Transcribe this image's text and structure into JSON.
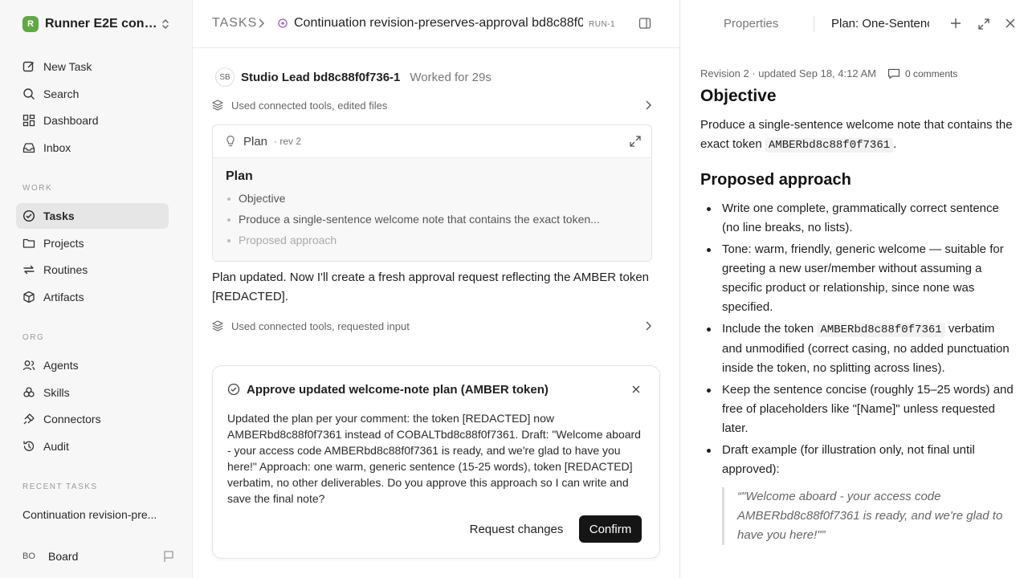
{
  "workspace": {
    "name": "Runner E2E conti...",
    "logo_letter": "R"
  },
  "nav": {
    "new_task": "New Task",
    "search": "Search",
    "dashboard": "Dashboard",
    "inbox": "Inbox"
  },
  "sections": {
    "work": "WORK",
    "org": "ORG",
    "recent": "RECENT TASKS"
  },
  "work_nav": {
    "tasks": "Tasks",
    "projects": "Projects",
    "routines": "Routines",
    "artifacts": "Artifacts"
  },
  "org_nav": {
    "agents": "Agents",
    "skills": "Skills",
    "connectors": "Connectors",
    "audit": "Audit"
  },
  "recent_tasks": [
    "Continuation revision-pre..."
  ],
  "user": {
    "initials": "BO",
    "name": "Board"
  },
  "breadcrumb": {
    "root": "TASKS",
    "title": "Continuation revision-preserves-approval bd8c88f0...",
    "run": "RUN-1"
  },
  "message": {
    "avatar": "SB",
    "author": "Studio Lead bd8c88f0f736-1",
    "worked": "Worked for 29s",
    "tools_1": "Used connected tools, edited files",
    "tools_2": "Used connected tools, requested input",
    "text": "Plan updated. Now I'll create a fresh approval request reflecting the AMBER token [REDACTED]."
  },
  "plan_card": {
    "label": "Plan",
    "rev": "· rev 2",
    "title": "Plan",
    "items": [
      "Objective",
      "Produce a single-sentence welcome note that contains the exact token...",
      "Proposed approach"
    ]
  },
  "approval": {
    "title": "Approve updated welcome-note plan (AMBER token)",
    "body": "Updated the plan per your comment: the token [REDACTED] now AMBERbd8c88f0f7361 instead of COBALTbd8c88f0f7361. Draft: \"Welcome aboard - your access code AMBERbd8c88f0f7361 is ready, and we're glad to have you here!\" Approach: one warm, generic sentence (15-25 words), token [REDACTED] verbatim, no other deliverables. Do you approve this approach so I can write and save the final note?",
    "request_changes": "Request changes",
    "confirm": "Confirm"
  },
  "right_panel": {
    "tab_properties": "Properties",
    "tab_plan": "Plan: One-Sentence",
    "meta": "Revision 2 · updated Sep 18, 4:12 AM",
    "comments": "0 comments",
    "objective_heading": "Objective",
    "objective_pre": "Produce a single-sentence welcome note that contains the exact token",
    "token": "AMBERbd8c88f0f7361",
    "objective_post": ".",
    "approach_heading": "Proposed approach",
    "bullet_1": "Write one complete, grammatically correct sentence (no line breaks, no lists).",
    "bullet_2": "Tone: warm, friendly, generic welcome — suitable for greeting a new user/member without assuming a specific product or relationship, since none was specified.",
    "bullet_3_pre": "Include the token",
    "bullet_3_post": "verbatim and unmodified (correct casing, no added punctuation inside the token, no splitting across lines).",
    "bullet_4": "Keep the sentence concise (roughly 15–25 words) and free of placeholders like \"[Name]\" unless requested later.",
    "bullet_5": "Draft example (for illustration only, not final until approved):",
    "quote": "“\"Welcome aboard - your access code AMBERbd8c88f0f7361 is ready, and we're glad to have you here!\"”"
  },
  "colors": {
    "accent_green": "#5fa843",
    "confirm_bg": "#151515",
    "active_nav": "#e6e6e6"
  },
  "icons": [
    "edit-icon",
    "search-icon",
    "dashboard-icon",
    "inbox-icon",
    "tasks-icon",
    "folder-icon",
    "routines-icon",
    "cube-icon",
    "agents-icon",
    "skills-icon",
    "connectors-icon",
    "audit-icon",
    "flag-icon",
    "chevron-right-icon",
    "layers-icon",
    "lightbulb-icon",
    "expand-icon",
    "check-circle-icon",
    "close-icon",
    "plus-icon",
    "comment-icon",
    "panel-toggle-icon"
  ]
}
